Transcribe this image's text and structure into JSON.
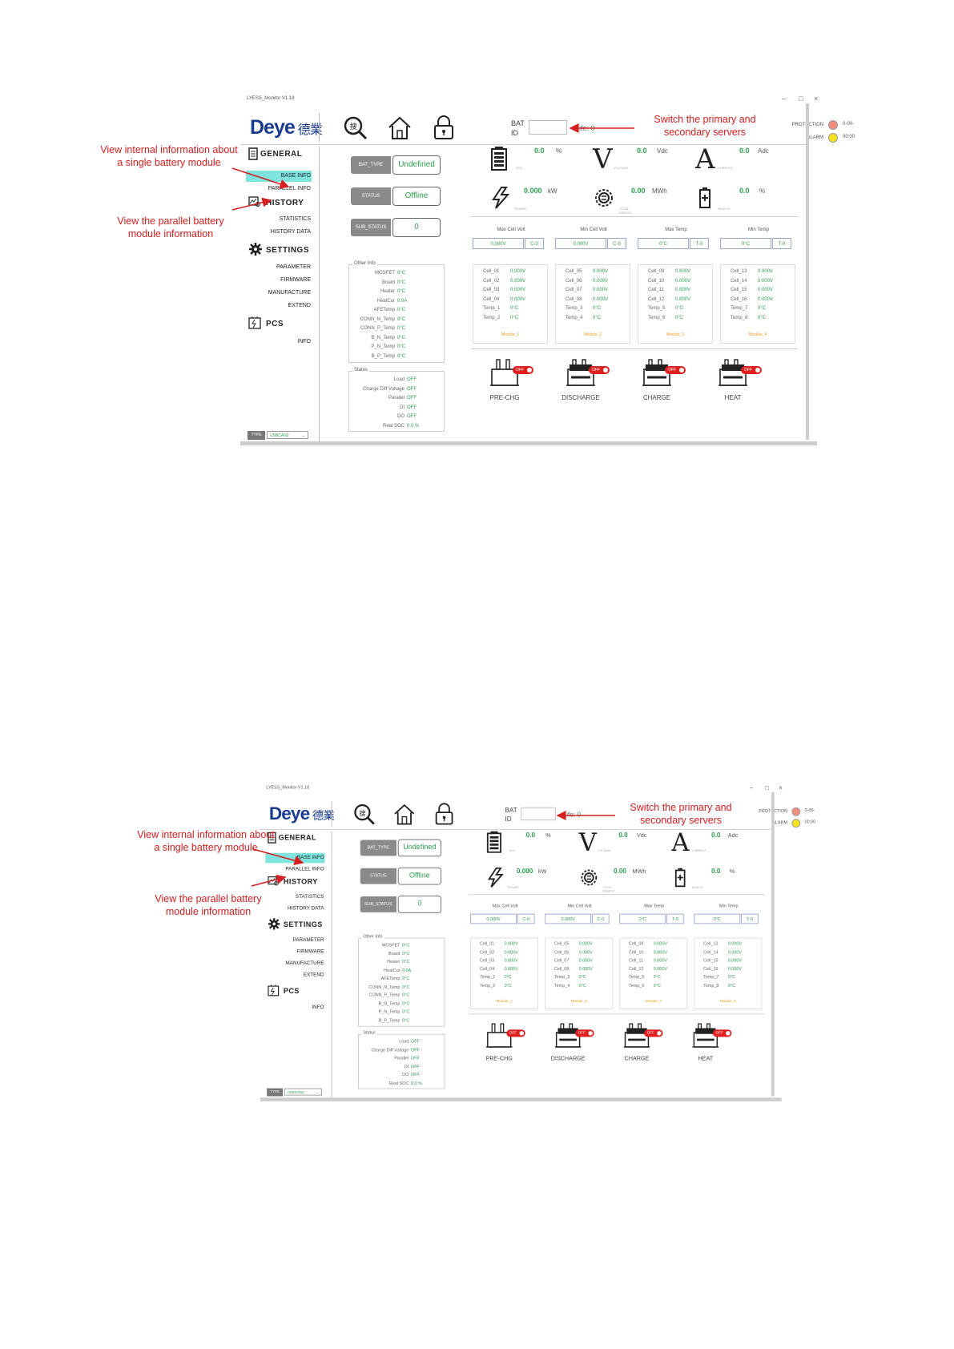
{
  "app": {
    "window_title": "LYESS_Monitor V1.18",
    "logo": "Deye",
    "logo_cn": "德業"
  },
  "header": {
    "bat_id_label": "BAT\nID",
    "bat_id_value": "",
    "life_label": "Life:",
    "life_value": "0",
    "protection_label": "PROTECTION",
    "alarm_label": "ALARM",
    "protection_time": "0-00-",
    "alarm_time": "00:00",
    "protection_color": "#f08f80",
    "alarm_color": "#f4e21c"
  },
  "sidebar": {
    "general": "GENERAL",
    "base_info": "BASE INFO",
    "parallel_info": "PARALLEL INFO",
    "history": "HISTORY",
    "statistics": "STATISTICS",
    "history_data": "HISTORY DATA",
    "settings": "SETTINGS",
    "parameter": "PARAMETER",
    "firmware": "FIRMWARE",
    "manufacture": "MANUFACTURE",
    "extend": "EXTEND",
    "pcs": "PCS",
    "info": "INFO",
    "type_label": "TYPE",
    "type_value": "USBCAN2"
  },
  "status_tags": {
    "bat_type_label": "BAT_TYPE",
    "bat_type_value": "Undefined",
    "status_label": "STATUS",
    "status_value": "Offline",
    "sub_status_label": "SUB_STATUS",
    "sub_status_value": "0"
  },
  "other_info": {
    "title": "Other Info",
    "rows": [
      {
        "k": "MOSFET",
        "v": "0°C"
      },
      {
        "k": "Board",
        "v": "0°C"
      },
      {
        "k": "Heater",
        "v": "0°C"
      },
      {
        "k": "HeatCur",
        "v": "0.0A"
      },
      {
        "k": "AFETemp",
        "v": "0°C"
      },
      {
        "k": "CONN_N_Temp",
        "v": "0°C"
      },
      {
        "k": "CONN_P_Temp",
        "v": "0°C"
      },
      {
        "k": "B_N_Temp",
        "v": "0°C"
      },
      {
        "k": "P_N_Temp",
        "v": "0°C"
      },
      {
        "k": "B_P_Temp",
        "v": "0°C"
      }
    ]
  },
  "status_box": {
    "title": "Status",
    "rows": [
      {
        "k": "Load",
        "v": "OFF"
      },
      {
        "k": "Charge Diff Voltage",
        "v": "OFF"
      },
      {
        "k": "Parallel",
        "v": "OFF"
      },
      {
        "k": "DI",
        "v": "OFF"
      },
      {
        "k": "DO",
        "v": "OFF"
      },
      {
        "k": "Real SOC",
        "v": "0.0 %"
      }
    ]
  },
  "metrics": {
    "soc": {
      "value": "0.0",
      "unit": "%",
      "label": "SOC"
    },
    "voltage": {
      "value": "0.0",
      "unit": "Vdc",
      "label": "VOLTAGE"
    },
    "current": {
      "value": "0.0",
      "unit": "Adc",
      "label": "CURRENT"
    },
    "power": {
      "value": "0.000",
      "unit": "kW",
      "label": "POWER"
    },
    "energy": {
      "value": "0.00",
      "unit": "MWh",
      "label": "TOTAL ENERGY"
    },
    "health": {
      "value": "0.0",
      "unit": "%",
      "label": "HEALTH"
    }
  },
  "cell_summary": {
    "max_cell_volt": {
      "label": "Max Cell Volt",
      "value": "0.000V",
      "idx": "C-0"
    },
    "min_cell_volt": {
      "label": "Min Cell Volt",
      "value": "0.000V",
      "idx": "C-0"
    },
    "max_temp": {
      "label": "Max Temp",
      "value": "0°C",
      "idx": "T-0"
    },
    "min_temp": {
      "label": "Min Temp",
      "value": "0°C",
      "idx": "T-0"
    }
  },
  "modules": [
    {
      "name": "Module_1",
      "rows": [
        {
          "k": "Cell_01",
          "v": "0.000V"
        },
        {
          "k": "Cell_02",
          "v": "0.000V"
        },
        {
          "k": "Cell_03",
          "v": "0.000V"
        },
        {
          "k": "Cell_04",
          "v": "0.000V"
        },
        {
          "k": "Temp_1",
          "v": "0°C"
        },
        {
          "k": "Temp_2",
          "v": "0°C"
        }
      ]
    },
    {
      "name": "Module_2",
      "rows": [
        {
          "k": "Cell_05",
          "v": "0.000V"
        },
        {
          "k": "Cell_06",
          "v": "0.000V"
        },
        {
          "k": "Cell_07",
          "v": "0.000V"
        },
        {
          "k": "Cell_08",
          "v": "0.000V"
        },
        {
          "k": "Temp_3",
          "v": "0°C"
        },
        {
          "k": "Temp_4",
          "v": "0°C"
        }
      ]
    },
    {
      "name": "Module_3",
      "rows": [
        {
          "k": "Cell_09",
          "v": "0.000V"
        },
        {
          "k": "Cell_10",
          "v": "0.000V"
        },
        {
          "k": "Cell_11",
          "v": "0.000V"
        },
        {
          "k": "Cell_12",
          "v": "0.000V"
        },
        {
          "k": "Temp_5",
          "v": "0°C"
        },
        {
          "k": "Temp_6",
          "v": "0°C"
        }
      ]
    },
    {
      "name": "Module_4",
      "rows": [
        {
          "k": "Cell_13",
          "v": "0.000V"
        },
        {
          "k": "Cell_14",
          "v": "0.000V"
        },
        {
          "k": "Cell_15",
          "v": "0.000V"
        },
        {
          "k": "Cell_16",
          "v": "0.000V"
        },
        {
          "k": "Temp_7",
          "v": "0°C"
        },
        {
          "k": "Temp_8",
          "v": "0°C"
        }
      ]
    }
  ],
  "relays": [
    {
      "label": "PRE-CHG",
      "state": "OFF"
    },
    {
      "label": "DISCHARGE",
      "state": "OFF"
    },
    {
      "label": "CHARGE",
      "state": "OFF"
    },
    {
      "label": "HEAT",
      "state": "OFF"
    }
  ],
  "annotations": {
    "base_info": "View internal information about\na single battery module",
    "parallel_info": "View the parallel battery\nmodule information",
    "servers": "Switch the primary and\nsecondary servers"
  },
  "colors": {
    "value_green": "#2a9d4a",
    "annotation_red": "#d42020",
    "selected_nav": "#7fe3de",
    "relay_off": "#e02020",
    "module_label": "#e69c1c"
  }
}
